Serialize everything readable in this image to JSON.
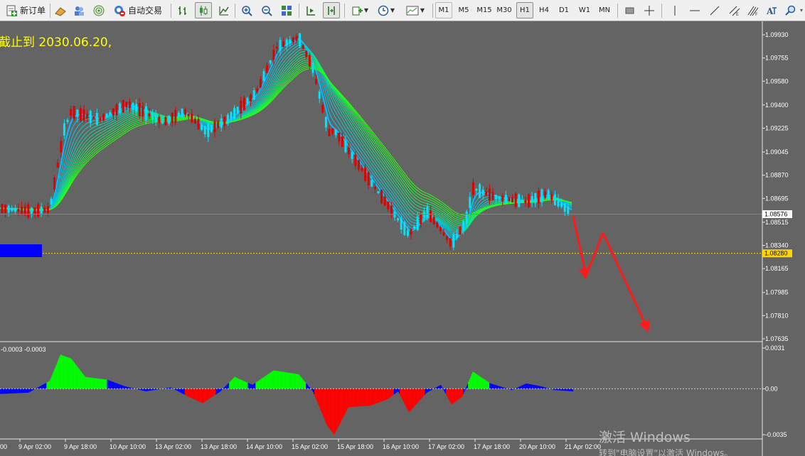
{
  "toolbar": {
    "new_order_label": "新订单",
    "auto_trade_label": "自动交易",
    "timeframes": [
      "M1",
      "M5",
      "M15",
      "M30",
      "H1",
      "H4",
      "D1",
      "W1",
      "MN"
    ],
    "active_timeframe": "H1"
  },
  "main_chart": {
    "annotation": "截止到 2030.06.20,",
    "price_labels": [
      "1.09930",
      "1.09755",
      "1.09580",
      "1.09400",
      "1.09225",
      "1.09045",
      "1.08870",
      "1.08695",
      "1.08515",
      "1.08340",
      "1.08165",
      "1.07985",
      "1.07810",
      "1.07635"
    ],
    "current_price": "1.08576",
    "level_price": "1.08280"
  },
  "indicator": {
    "label": "-0.0003 -0.0003",
    "labels": [
      "0.0031",
      "0.00",
      "-0.0035"
    ]
  },
  "time_axis": {
    "labels": [
      "9 Apr 02:00",
      "9 Apr 18:00",
      "10 Apr 10:00",
      "13 Apr 02:00",
      "13 Apr 18:00",
      "14 Apr 10:00",
      "15 Apr 02:00",
      "15 Apr 18:00",
      "16 Apr 10:00",
      "17 Apr 02:00",
      "17 Apr 18:00",
      "20 Apr 10:00",
      "21 Apr 02:00"
    ],
    "left_edge_label": "00"
  },
  "watermark": {
    "line1": "激活 Windows",
    "line2": "转到\"电脑设置\"以激活 Windows。"
  },
  "colors": {
    "chart_bg": "#646464",
    "bull_candle": "#00e5ff",
    "bear_candle": "#e00000",
    "level_line": "#ffd700",
    "current_price_line": "#5a8fbf",
    "annotation": "#ffff00",
    "hist_positive": "#00ff00",
    "hist_negative": "#ff0000",
    "hist_neutral": "#0000ff",
    "forecast_arrow": "#ff1a1a"
  }
}
